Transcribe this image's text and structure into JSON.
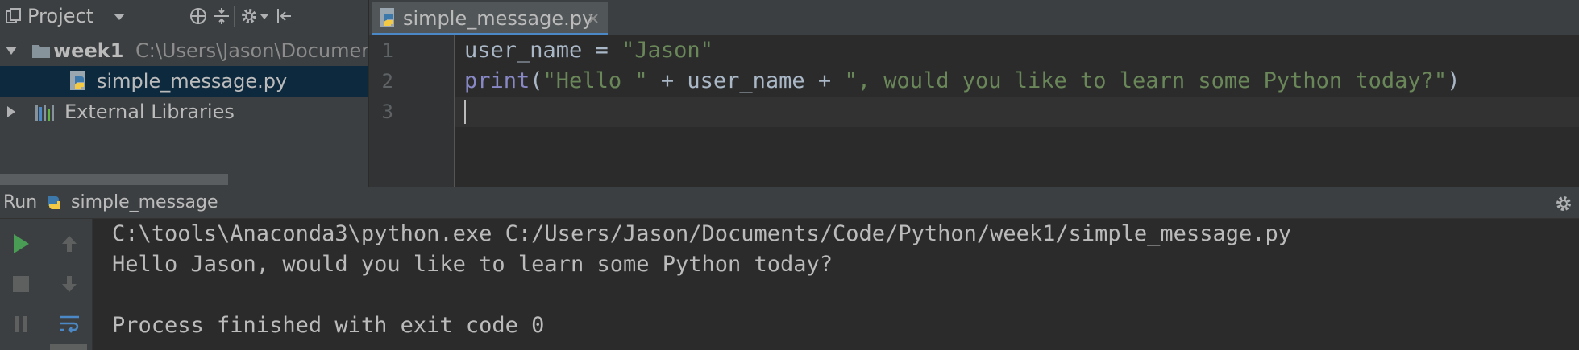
{
  "project": {
    "title": "Project",
    "tree": [
      {
        "label": "week1",
        "path": "C:\\Users\\Jason\\Documen"
      },
      {
        "label": "simple_message.py"
      },
      {
        "label": "External Libraries"
      }
    ]
  },
  "editor": {
    "tab_label": "simple_message.py",
    "line_numbers": [
      "1",
      "2",
      "3"
    ]
  },
  "run": {
    "label": "Run",
    "config": "simple_message",
    "output": [
      "C:\\tools\\Anaconda3\\python.exe C:/Users/Jason/Documents/Code/Python/week1/simple_message.py",
      "Hello Jason, would you like to learn some Python today?",
      "",
      "Process finished with exit code 0"
    ]
  },
  "colors": {
    "keyword_builtin": "#8888c6",
    "string": "#6a8759",
    "default_code": "#a9b7c6",
    "selection": "#0d293e",
    "run_green": "#499c54"
  }
}
